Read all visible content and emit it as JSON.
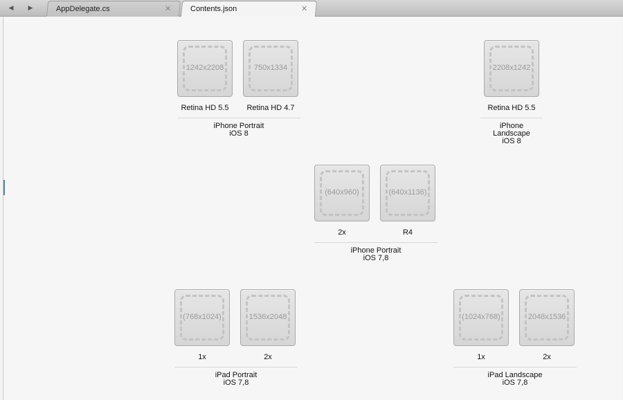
{
  "tabs": [
    {
      "label": "AppDelegate.cs",
      "close": "✕"
    },
    {
      "label": "Contents.json",
      "close": "✕"
    }
  ],
  "nav": {
    "back": "◀",
    "forward": "▶"
  },
  "groups": {
    "iphone_portrait_ios8": {
      "slots": [
        {
          "size": "1242x2208",
          "label": "Retina HD 5.5"
        },
        {
          "size": "750x1334",
          "label": "Retina HD 4.7"
        }
      ],
      "title": "iPhone Portrait",
      "subtitle": "iOS 8"
    },
    "iphone_landscape_ios8": {
      "slots": [
        {
          "size": "2208x1242",
          "label": "Retina HD 5.5"
        }
      ],
      "title": "iPhone Landscape",
      "subtitle": "iOS 8"
    },
    "iphone_portrait_ios78": {
      "slots": [
        {
          "size": "(640x960)",
          "label": "2x"
        },
        {
          "size": "(640x1136)",
          "label": "R4"
        }
      ],
      "title": "iPhone Portrait",
      "subtitle": "iOS 7,8"
    },
    "ipad_portrait": {
      "slots": [
        {
          "size": "(768x1024)",
          "label": "1x"
        },
        {
          "size": "1536x2048",
          "label": "2x"
        }
      ],
      "title": "iPad Portrait",
      "subtitle": "iOS 7,8"
    },
    "ipad_landscape": {
      "slots": [
        {
          "size": "(1024x768)",
          "label": "1x"
        },
        {
          "size": "2048x1536",
          "label": "2x"
        }
      ],
      "title": "iPad Landscape",
      "subtitle": "iOS 7,8"
    }
  }
}
